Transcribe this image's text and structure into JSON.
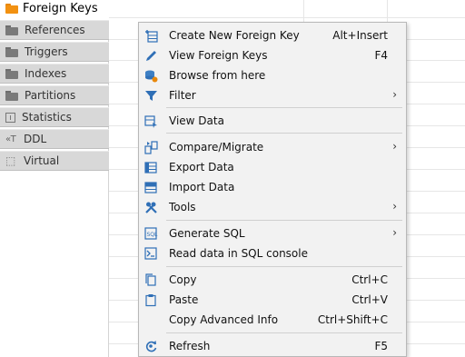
{
  "top_tab": {
    "label": "Foreign Keys"
  },
  "side_tabs": [
    {
      "label": "References",
      "icon": "folder-icon"
    },
    {
      "label": "Triggers",
      "icon": "folder-icon"
    },
    {
      "label": "Indexes",
      "icon": "folder-icon"
    },
    {
      "label": "Partitions",
      "icon": "folder-icon"
    },
    {
      "label": "Statistics",
      "icon": "statistics-icon"
    },
    {
      "label": "DDL",
      "icon": "ddl-icon"
    },
    {
      "label": "Virtual",
      "icon": "virtual-icon"
    }
  ],
  "menu": {
    "items": [
      {
        "label": "Create New Foreign Key",
        "shortcut": "Alt+Insert",
        "icon": "create-key-icon"
      },
      {
        "label": "View Foreign Keys",
        "shortcut": "F4",
        "icon": "pencil-icon"
      },
      {
        "label": "Browse from here",
        "shortcut": "",
        "icon": "browse-icon"
      },
      {
        "label": "Filter",
        "shortcut": "",
        "icon": "filter-icon",
        "submenu": true
      },
      {
        "label": "View Data",
        "shortcut": "",
        "icon": "view-data-icon"
      },
      {
        "label": "Compare/Migrate",
        "shortcut": "",
        "icon": "compare-icon",
        "submenu": true
      },
      {
        "label": "Export Data",
        "shortcut": "",
        "icon": "export-icon"
      },
      {
        "label": "Import Data",
        "shortcut": "",
        "icon": "import-icon"
      },
      {
        "label": "Tools",
        "shortcut": "",
        "icon": "tools-icon",
        "submenu": true
      },
      {
        "label": "Generate SQL",
        "shortcut": "",
        "icon": "generate-sql-icon",
        "submenu": true
      },
      {
        "label": "Read data in SQL console",
        "shortcut": "",
        "icon": "sql-console-icon"
      },
      {
        "label": "Copy",
        "shortcut": "Ctrl+C",
        "icon": "copy-icon"
      },
      {
        "label": "Paste",
        "shortcut": "Ctrl+V",
        "icon": "paste-icon"
      },
      {
        "label": "Copy Advanced Info",
        "shortcut": "Ctrl+Shift+C",
        "icon": ""
      },
      {
        "label": "Refresh",
        "shortcut": "F5",
        "icon": "refresh-icon"
      }
    ],
    "submenu_arrow": "›"
  },
  "colors": {
    "accent_blue": "#2f6fb6",
    "folder_orange": "#f29111",
    "menu_bg": "#f2f2f2"
  }
}
